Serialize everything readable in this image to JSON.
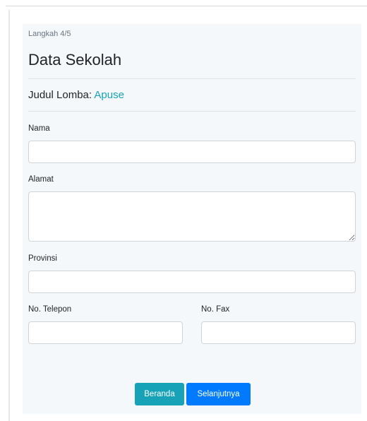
{
  "form": {
    "step": "Langkah 4/5",
    "title": "Data Sekolah",
    "judul_label": "Judul Lomba:",
    "judul_value": "Apuse",
    "fields": {
      "nama": {
        "label": "Nama",
        "value": ""
      },
      "alamat": {
        "label": "Alamat",
        "value": ""
      },
      "provinsi": {
        "label": "Provinsi",
        "value": ""
      },
      "telepon": {
        "label": "No. Telepon",
        "value": ""
      },
      "fax": {
        "label": "No. Fax",
        "value": ""
      }
    },
    "buttons": {
      "beranda": "Beranda",
      "next": "Selanjutnya"
    }
  },
  "colors": {
    "card_bg": "#f4f8fb",
    "accent_info": "#17a2b8",
    "accent_primary": "#007bff"
  }
}
